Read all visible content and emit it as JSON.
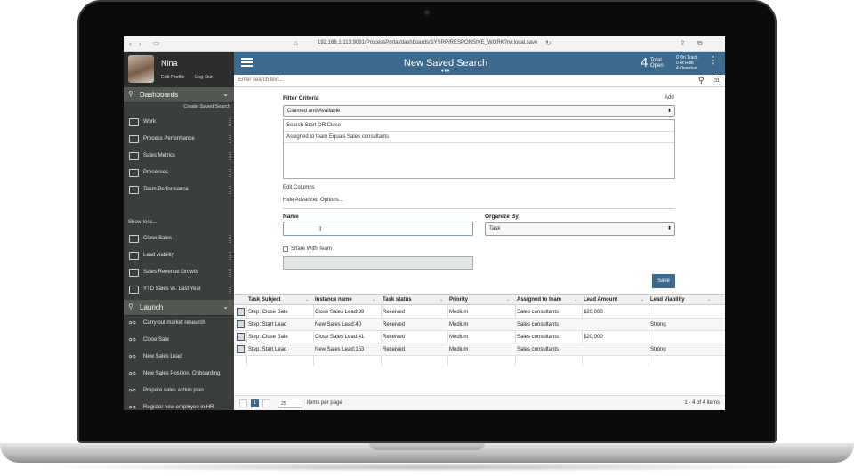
{
  "browser": {
    "url": "192.168.1.113:9091/ProcessPortal/dashboards/SYSRP/RESPONSIVE_WORK?rw.local.save"
  },
  "profile": {
    "name": "Nina",
    "edit_profile": "Edit Profile",
    "log_out": "Log Out"
  },
  "sidebar": {
    "dashboards_header": "Dashboards",
    "create_saved_search": "Create Saved Search",
    "dashboards": [
      {
        "label": "Work",
        "icon": "work-icon"
      },
      {
        "label": "Process Performance",
        "icon": "chart-line-icon"
      },
      {
        "label": "Sales Metrics",
        "icon": "dashboard-icon"
      },
      {
        "label": "Processes",
        "icon": "processes-icon"
      },
      {
        "label": "Team Performance",
        "icon": "team-icon"
      }
    ],
    "show_less": "Show less...",
    "more_dashboards": [
      {
        "label": "Close Sales",
        "icon": "dashboard-icon"
      },
      {
        "label": "Lead viability",
        "icon": "dashboard-icon"
      },
      {
        "label": "Sales Revenue Growth",
        "icon": "dashboard-icon"
      },
      {
        "label": "YTD Sales vs. Last Year",
        "icon": "dashboard-icon"
      }
    ],
    "launch_header": "Launch",
    "launch": [
      {
        "label": "Carry out market research",
        "icon": "process-flow-icon"
      },
      {
        "label": "Close Sale",
        "icon": "process-flow-icon"
      },
      {
        "label": "New Sales Lead",
        "icon": "process-flow-icon"
      },
      {
        "label": "New Sales Position, Onboarding",
        "icon": "process-flow-icon"
      },
      {
        "label": "Prepare sales action plan",
        "icon": "process-flow-icon"
      },
      {
        "label": "Register new employee in HR System",
        "icon": "process-flow-icon"
      }
    ]
  },
  "header": {
    "title": "New Saved Search",
    "dots": "•••",
    "open_count": "4",
    "open_label_1": "Total",
    "open_label_2": "Open",
    "on_track": "0 On Track",
    "at_risk": "0 At Risk",
    "overdue": "4 Overdue",
    "accent": "#3d6a8c"
  },
  "search": {
    "placeholder": "Enter search text..."
  },
  "filter": {
    "criteria_label": "Filter Criteria",
    "add": "Add",
    "selected_option": "Claimed and Available",
    "criteria": [
      "Search Start OR Close",
      "Assigned to team Equals Sales consultants"
    ],
    "edit_columns": "Edit Columns",
    "hide_advanced": "Hide Advanced Options...",
    "name_label": "Name",
    "name_value": "",
    "organize_label": "Organize By",
    "organize_value": "Task",
    "share_label": "Share With Team",
    "save": "Save"
  },
  "table": {
    "columns": [
      "Task Subject",
      "Instance name",
      "Task status",
      "Priority",
      "Assigned to team",
      "Lead Amount",
      "Lead Viability"
    ],
    "rows": [
      [
        "Step: Close Sale",
        "Close Sales Lead:39",
        "Received",
        "Medium",
        "Sales consultants",
        "$20,000",
        ""
      ],
      [
        "Step: Start Lead",
        "New Sales Lead:40",
        "Received",
        "Medium",
        "Sales consultants",
        "",
        "Strong"
      ],
      [
        "Step: Close Sale",
        "Close Sales Lead:41",
        "Received",
        "Medium",
        "Sales consultants",
        "$20,000",
        ""
      ],
      [
        "Step: Start Lead",
        "New Sales Lead:153",
        "Received",
        "Medium",
        "Sales consultants",
        "",
        "Strong"
      ]
    ]
  },
  "pager": {
    "current": "1",
    "page_size": "25",
    "per_page_label": "items per page",
    "count": "1 - 4 of 4 items"
  }
}
